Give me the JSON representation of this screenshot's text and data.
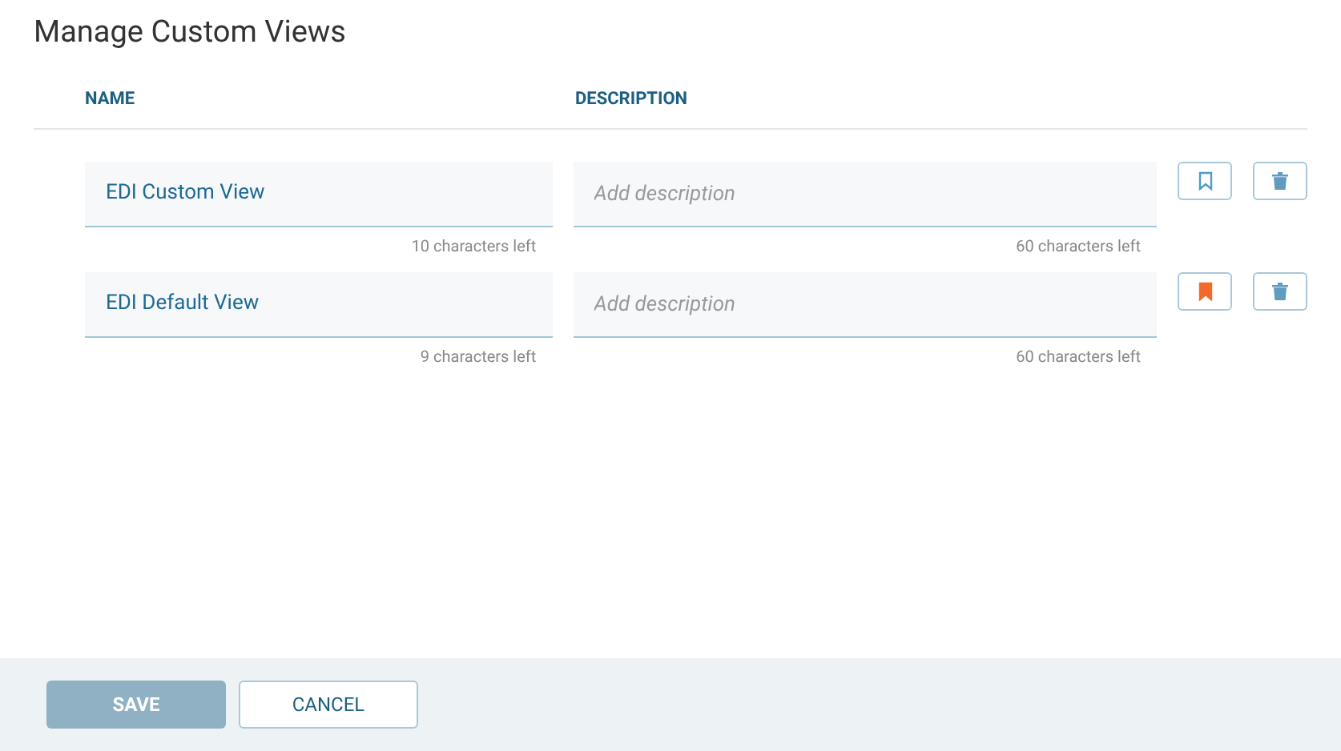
{
  "title": "Manage Custom Views",
  "columns": [
    "NAME",
    "DESCRIPTION"
  ],
  "views": [
    {
      "name": "EDI Custom View",
      "name_counter": "10 characters left",
      "description_placeholder": "Add description",
      "description_counter": "60 characters left",
      "default": false
    },
    {
      "name": "EDI Default View",
      "name_counter": "9 characters left",
      "description_placeholder": "Add description",
      "description_counter": "60 characters left",
      "default": true
    }
  ],
  "buttons": [
    {
      "label": "SAVE",
      "kind": "primary",
      "disabled": true
    },
    {
      "label": "CANCEL",
      "kind": "secondary",
      "disabled": false
    }
  ]
}
